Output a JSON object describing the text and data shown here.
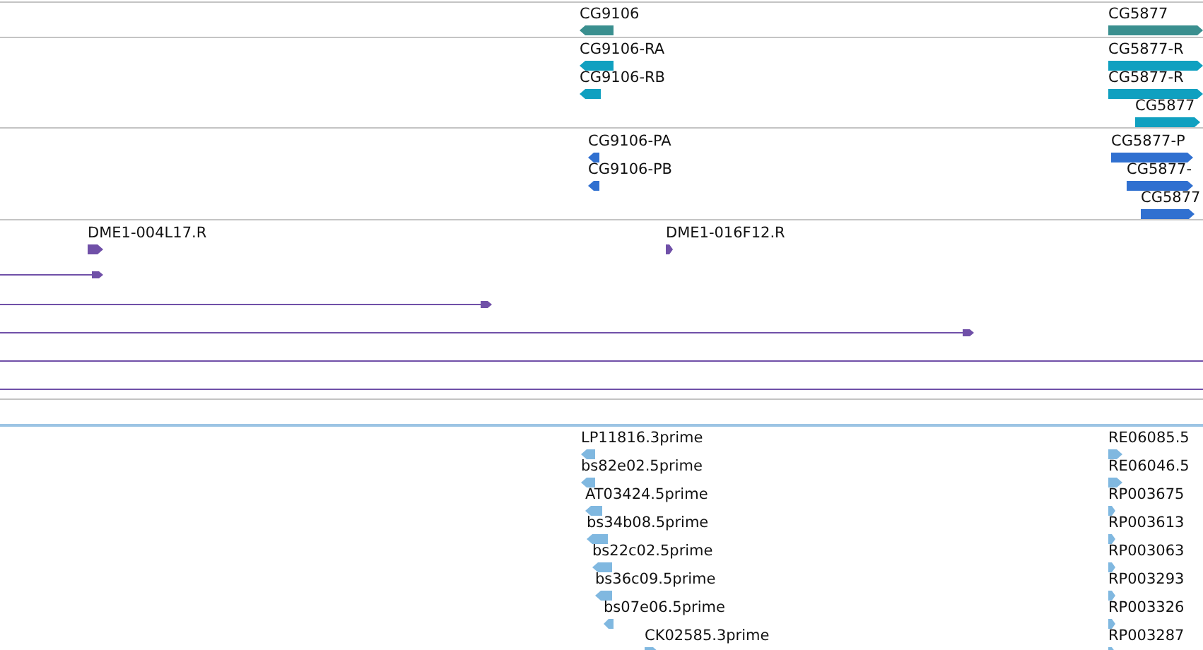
{
  "tracks": [
    {
      "kind": "features",
      "color": "#3a8f8f",
      "features": [
        {
          "kind": "gene",
          "label": "CG9106",
          "reverse": true
        },
        {
          "kind": "gene",
          "label": "CG5877",
          "reverse": false
        }
      ]
    },
    {
      "kind": "features",
      "color": "#10a0c0",
      "features": [
        {
          "kind": "gene",
          "label": "CG9106-RA",
          "reverse": true
        },
        {
          "kind": "gene",
          "label": "CG9106-RB",
          "reverse": true
        },
        {
          "kind": "gene",
          "label": "CG5877-R",
          "reverse": false
        },
        {
          "kind": "gene",
          "label": "CG5877-R",
          "reverse": false
        },
        {
          "kind": "gene",
          "label": "CG5877",
          "reverse": false
        }
      ]
    },
    {
      "kind": "features",
      "color": "#3070d0",
      "features": [
        {
          "kind": "gene",
          "label": "CG9106-PA",
          "reverse": true
        },
        {
          "kind": "gene",
          "label": "CG9106-PB",
          "reverse": true
        },
        {
          "kind": "gene",
          "label": "CG5877-P",
          "reverse": false
        },
        {
          "kind": "gene",
          "label": "CG5877-",
          "reverse": false
        },
        {
          "kind": "gene",
          "label": "CG5877",
          "reverse": false
        }
      ]
    },
    {
      "kind": "features",
      "color": "#7050a8",
      "features": [
        {
          "kind": "gene",
          "label": "DME1-004L17.R",
          "reverse": false
        },
        {
          "kind": "gene",
          "label": "DME1-016F12.R",
          "reverse": false
        },
        {
          "kind": "read",
          "arrow": true
        },
        {
          "kind": "read",
          "arrow": true
        },
        {
          "kind": "read",
          "arrow": true
        },
        {
          "kind": "read",
          "arrow": false
        },
        {
          "kind": "read",
          "arrow": false
        }
      ]
    },
    {
      "kind": "spacer"
    },
    {
      "kind": "features",
      "color": "#80b8e0",
      "features": [
        {
          "kind": "gene",
          "label": "LP11816.3prime",
          "reverse": true
        },
        {
          "kind": "gene",
          "label": "bs82e02.5prime",
          "reverse": true
        },
        {
          "kind": "gene",
          "label": "AT03424.5prime",
          "reverse": true
        },
        {
          "kind": "gene",
          "label": "bs34b08.5prime",
          "reverse": true
        },
        {
          "kind": "gene",
          "label": "bs22c02.5prime",
          "reverse": true
        },
        {
          "kind": "gene",
          "label": "bs36c09.5prime",
          "reverse": true
        },
        {
          "kind": "gene",
          "label": "bs07e06.5prime",
          "reverse": true
        },
        {
          "kind": "gene",
          "label": "CK02585.3prime",
          "reverse": false
        },
        {
          "kind": "gene",
          "label": "RE06085.5",
          "reverse": false
        },
        {
          "kind": "gene",
          "label": "RE06046.5",
          "reverse": false
        },
        {
          "kind": "gene",
          "label": "RP003675",
          "reverse": false
        },
        {
          "kind": "gene",
          "label": "RP003613",
          "reverse": false
        },
        {
          "kind": "gene",
          "label": "RP003063",
          "reverse": false
        },
        {
          "kind": "gene",
          "label": "RP003293",
          "reverse": false
        },
        {
          "kind": "gene",
          "label": "RP003326",
          "reverse": false
        },
        {
          "kind": "gene",
          "label": "RP003287",
          "reverse": false
        }
      ]
    }
  ]
}
